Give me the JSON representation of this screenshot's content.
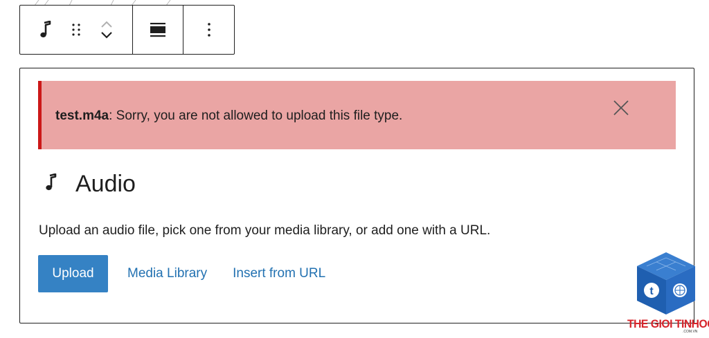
{
  "toolbar": {
    "block_type": "audio-icon",
    "drag": "drag-handle-icon",
    "move_up": "chevron-up-icon",
    "move_down": "chevron-down-icon",
    "align": "align-icon",
    "options": "more-vertical-icon"
  },
  "notice": {
    "filename": "test.m4a",
    "message": ": Sorry, you are not allowed to upload this file type.",
    "close_icon": "close-icon",
    "background": "#eaa5a4",
    "border_color": "#cc1818"
  },
  "placeholder": {
    "icon": "audio-icon",
    "title": "Audio",
    "instructions": "Upload an audio file, pick one from your media library, or add one with a URL.",
    "upload_label": "Upload",
    "media_library_label": "Media Library",
    "insert_url_label": "Insert from URL",
    "accent_color": "#3582c4",
    "link_color": "#2271b1"
  },
  "watermark": {
    "brand": "THE GIOI TINHOC",
    "domain": ".COM.VN"
  }
}
